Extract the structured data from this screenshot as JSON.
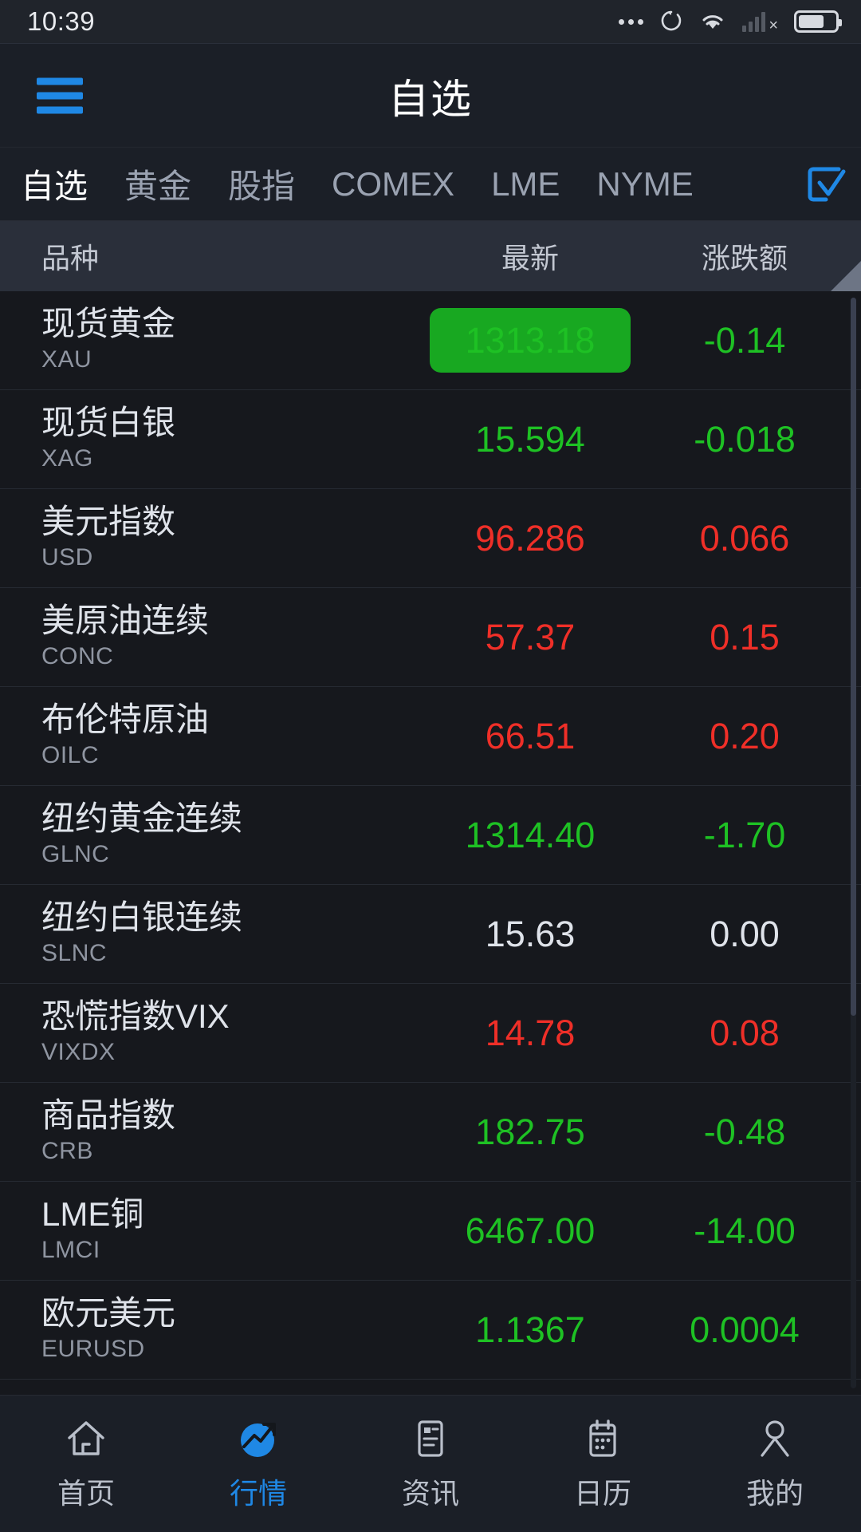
{
  "statusbar": {
    "time": "10:39",
    "icons": [
      "more-dots-icon",
      "sync-icon",
      "wifi-icon",
      "signal-bars-icon",
      "battery-icon"
    ]
  },
  "header": {
    "menu_icon": "hamburger-menu-icon",
    "title": "自选"
  },
  "tabs": {
    "items": [
      {
        "label": "自选",
        "active": true
      },
      {
        "label": "黄金",
        "active": false
      },
      {
        "label": "股指",
        "active": false
      },
      {
        "label": "COMEX",
        "active": false
      },
      {
        "label": "LME",
        "active": false
      },
      {
        "label": "NYME",
        "active": false
      }
    ],
    "edit_icon": "checkbox-check-icon"
  },
  "columns": {
    "name": "品种",
    "last": "最新",
    "change": "涨跌额"
  },
  "colors": {
    "up": "#ef2f28",
    "down": "#1ec124",
    "flat": "#dfe3ea",
    "accent": "#1f88e5",
    "pill_green": "#18a821"
  },
  "quotes": [
    {
      "name": "现货黄金",
      "code": "XAU",
      "last": "1313.18",
      "change": "-0.14",
      "dir": "down",
      "highlight": "down"
    },
    {
      "name": "现货白银",
      "code": "XAG",
      "last": "15.594",
      "change": "-0.018",
      "dir": "down",
      "highlight": null
    },
    {
      "name": "美元指数",
      "code": "USD",
      "last": "96.286",
      "change": "0.066",
      "dir": "up",
      "highlight": null
    },
    {
      "name": "美原油连续",
      "code": "CONC",
      "last": "57.37",
      "change": "0.15",
      "dir": "up",
      "highlight": null
    },
    {
      "name": "布伦特原油",
      "code": "OILC",
      "last": "66.51",
      "change": "0.20",
      "dir": "up",
      "highlight": null
    },
    {
      "name": "纽约黄金连续",
      "code": "GLNC",
      "last": "1314.40",
      "change": "-1.70",
      "dir": "down",
      "highlight": null
    },
    {
      "name": "纽约白银连续",
      "code": "SLNC",
      "last": "15.63",
      "change": "0.00",
      "dir": "flat",
      "highlight": null
    },
    {
      "name": "恐慌指数VIX",
      "code": "VIXDX",
      "last": "14.78",
      "change": "0.08",
      "dir": "up",
      "highlight": null
    },
    {
      "name": "商品指数",
      "code": "CRB",
      "last": "182.75",
      "change": "-0.48",
      "dir": "down",
      "highlight": null
    },
    {
      "name": "LME铜",
      "code": "LMCI",
      "last": "6467.00",
      "change": "-14.00",
      "dir": "down",
      "highlight": null
    },
    {
      "name": "欧元美元",
      "code": "EURUSD",
      "last": "1.1367",
      "change": "0.0004",
      "dir": "down",
      "highlight": null
    }
  ],
  "bottomnav": {
    "items": [
      {
        "label": "首页",
        "icon": "home-icon",
        "active": false
      },
      {
        "label": "行情",
        "icon": "market-chart-icon",
        "active": true
      },
      {
        "label": "资讯",
        "icon": "news-icon",
        "active": false
      },
      {
        "label": "日历",
        "icon": "calendar-icon",
        "active": false
      },
      {
        "label": "我的",
        "icon": "profile-icon",
        "active": false
      }
    ]
  }
}
